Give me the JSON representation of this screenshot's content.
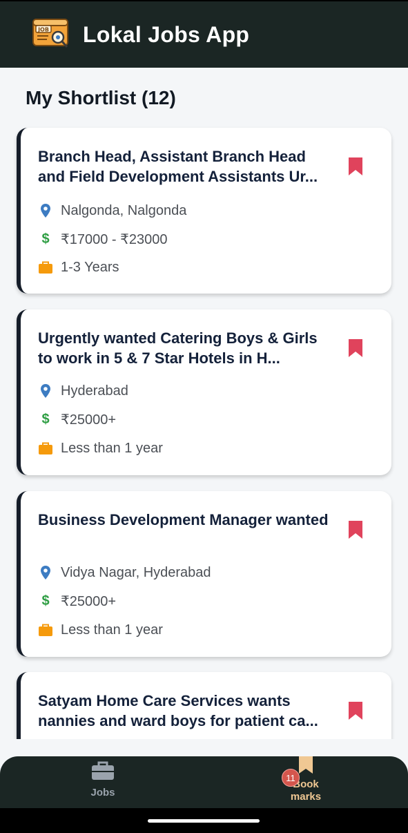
{
  "app": {
    "title": "Lokal Jobs App",
    "logo_text": "JOB"
  },
  "page": {
    "title": "My Shortlist (12)"
  },
  "jobs": [
    {
      "title": "Branch Head, Assistant Branch Head and Field Development Assistants Ur...",
      "location": "Nalgonda, Nalgonda",
      "salary": "₹17000 - ₹23000",
      "experience": "1-3 Years"
    },
    {
      "title": "Urgently wanted Catering Boys & Girls to work in 5 & 7 Star Hotels in H...",
      "location": "Hyderabad",
      "salary": "₹25000+",
      "experience": "Less than 1 year"
    },
    {
      "title": "Business Development Manager wanted",
      "location": "Vidya Nagar, Hyderabad",
      "salary": "₹25000+",
      "experience": "Less than 1 year"
    },
    {
      "title": "Satyam Home Care Services wants nannies and ward boys for patient ca...",
      "location": "",
      "salary": "",
      "experience": ""
    }
  ],
  "icons": {
    "location": "map-pin-icon",
    "salary": "dollar-icon",
    "experience": "briefcase-icon",
    "bookmark": "bookmark-icon"
  },
  "colors": {
    "header_bg": "#1b2624",
    "bookmark": "#e0435c",
    "pin": "#3d7cc2",
    "salary": "#2f9e44",
    "briefcase": "#f59a0c",
    "active_tab": "#f0c893"
  },
  "bottom_nav": {
    "jobs_label": "Jobs",
    "bookmarks_label_line1": "Book",
    "bookmarks_label_line2": "marks",
    "bookmarks_badge": "11"
  }
}
